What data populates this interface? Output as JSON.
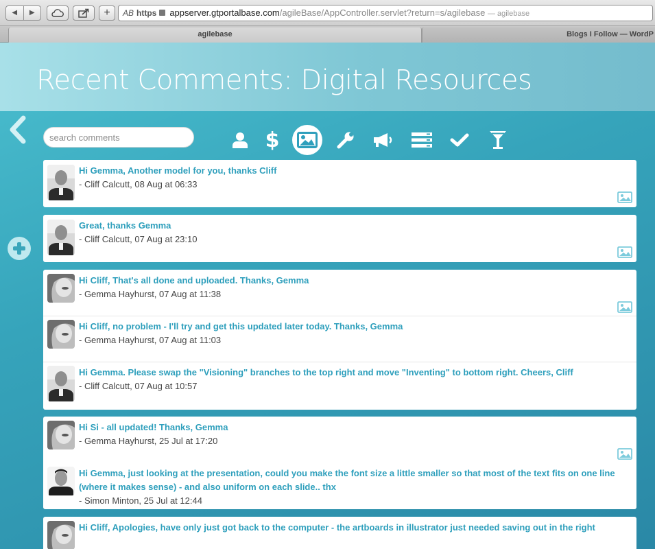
{
  "browser": {
    "reader_label": "AB",
    "url_scheme": "https",
    "url_host": "appserver.gtportalbase.com",
    "url_path": "/agileBase/AppController.servlet?return=s/agilebase",
    "url_title": "— agilebase",
    "tabs": [
      "agilebase",
      "Blogs I Follow — WordP"
    ]
  },
  "page": {
    "title": "Recent Comments: Digital Resources",
    "search_placeholder": "search comments"
  },
  "filters": [
    "user-icon",
    "dollar-icon",
    "image-icon",
    "wrench-icon",
    "megaphone-icon",
    "list-icon",
    "check-icon",
    "cocktail-icon"
  ],
  "active_filter": "image-icon",
  "groups": [
    {
      "comments": [
        {
          "text": "Hi Gemma, Another model for you, thanks Cliff",
          "meta": "- Cliff Calcutt, 08 Aug at 06:33",
          "author": "cliff"
        }
      ]
    },
    {
      "comments": [
        {
          "text": "Great, thanks Gemma",
          "meta": "- Cliff Calcutt, 07 Aug at 23:10",
          "author": "cliff"
        }
      ]
    },
    {
      "comments": [
        {
          "text": "Hi Cliff, That's all done and uploaded. Thanks, Gemma",
          "meta": "- Gemma Hayhurst, 07 Aug at 11:38",
          "author": "gemma"
        },
        {
          "text": "Hi Cliff, no problem - I'll try and get this updated later today. Thanks, Gemma",
          "meta": "- Gemma Hayhurst, 07 Aug at 11:03",
          "author": "gemma"
        },
        {
          "text": "Hi Gemma. Please swap the \"Visioning\" branches to the top right and move \"Inventing\" to bottom right. Cheers, Cliff",
          "meta": "- Cliff Calcutt, 07 Aug at 10:57",
          "author": "cliff"
        }
      ]
    },
    {
      "comments": [
        {
          "text": "Hi Si - all updated! Thanks, Gemma",
          "meta": "- Gemma Hayhurst, 25 Jul at 17:20",
          "author": "gemma"
        },
        {
          "text": "Hi Gemma, just looking at the presentation, could you make the font size a little smaller so that most of the text fits on one line (where it makes sense) - and also uniform on each slide.. thx",
          "meta": "- Simon Minton, 25 Jul at 12:44",
          "author": "simon"
        }
      ]
    },
    {
      "comments": [
        {
          "text": "Hi Cliff, Apologies, have only just got back to the computer - the artboards in illustrator just needed saving out in the right",
          "meta": "",
          "author": "gemma"
        }
      ]
    }
  ]
}
